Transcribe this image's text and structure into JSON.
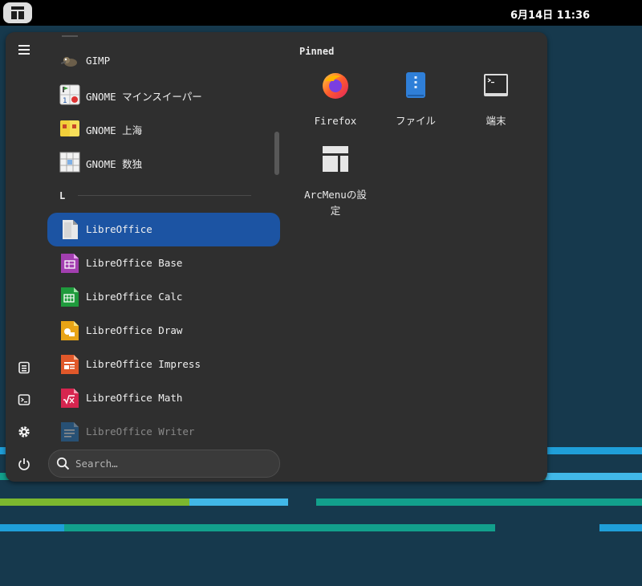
{
  "topbar": {
    "clock": "6月14日  11:36"
  },
  "menu": {
    "pinned_title": "Pinned",
    "apps": [
      {
        "label": "GIMP"
      },
      {
        "label": "GNOME マインスイーパー"
      },
      {
        "label": "GNOME 上海"
      },
      {
        "label": "GNOME 数独"
      },
      {
        "label": "LibreOffice"
      },
      {
        "label": "LibreOffice Base"
      },
      {
        "label": "LibreOffice Calc"
      },
      {
        "label": "LibreOffice Draw"
      },
      {
        "label": "LibreOffice Impress"
      },
      {
        "label": "LibreOffice Math"
      },
      {
        "label": "LibreOffice Writer"
      }
    ],
    "section_letter": "L",
    "search_placeholder": "Search…",
    "pinned": [
      {
        "label": "Firefox",
        "icon": "firefox-icon"
      },
      {
        "label": "ファイル",
        "icon": "files-icon"
      },
      {
        "label": "端末",
        "icon": "terminal-icon"
      },
      {
        "label": "ArcMenuの設定",
        "icon": "arcmenu-settings-icon"
      }
    ],
    "sidebar": [
      "menu-icon",
      "document-icon",
      "terminal-icon",
      "gear-icon",
      "power-icon"
    ]
  },
  "colors": {
    "desktop": "#16394d",
    "menu_bg": "#2f2f2f",
    "selection": "#1c54a3",
    "stripe_cyan": "#1f9fd9",
    "stripe_teal": "#12a08c",
    "stripe_green": "#7cb82f",
    "stripe_light": "#41b8e8"
  }
}
